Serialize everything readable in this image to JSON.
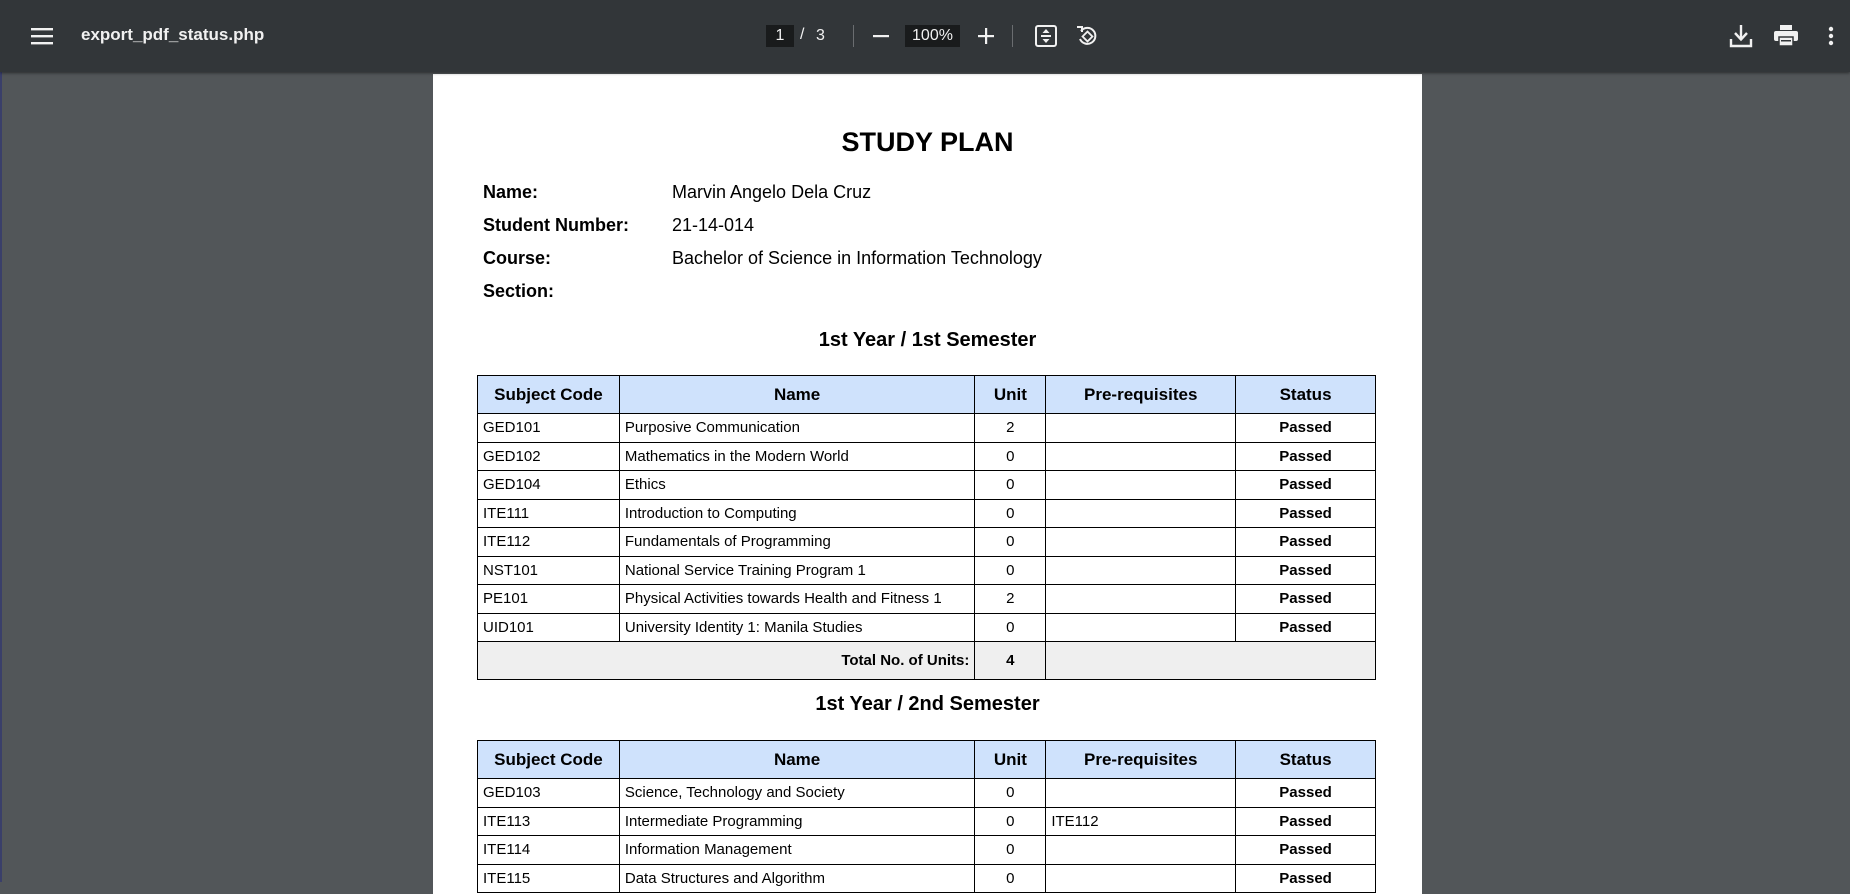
{
  "toolbar": {
    "file_name": "export_pdf_status.php",
    "current_page": "1",
    "page_separator": "/",
    "total_pages": "3",
    "zoom": "100%",
    "icons": [
      "menu-icon",
      "zoom-out-icon",
      "zoom-in-icon",
      "fit-page-icon",
      "rotate-icon",
      "download-icon",
      "print-icon",
      "more-vert-icon"
    ]
  },
  "document": {
    "title": "STUDY PLAN",
    "info": [
      {
        "label": "Name:",
        "value": "Marvin Angelo Dela Cruz"
      },
      {
        "label": "Student Number:",
        "value": "21-14-014"
      },
      {
        "label": "Course:",
        "value": "Bachelor of Science in Information Technology"
      },
      {
        "label": "Section:",
        "value": ""
      }
    ],
    "columns": [
      "Subject Code",
      "Name",
      "Unit",
      "Pre-requisites",
      "Status"
    ],
    "total_label": "Total No. of Units:",
    "semesters": [
      {
        "heading": "1st Year / 1st Semester",
        "rows": [
          {
            "code": "GED101",
            "name": "Purposive Communication",
            "unit": "2",
            "prereq": "",
            "status": "Passed"
          },
          {
            "code": "GED102",
            "name": "Mathematics in the Modern World",
            "unit": "0",
            "prereq": "",
            "status": "Passed"
          },
          {
            "code": "GED104",
            "name": "Ethics",
            "unit": "0",
            "prereq": "",
            "status": "Passed"
          },
          {
            "code": "ITE111",
            "name": "Introduction to Computing",
            "unit": "0",
            "prereq": "",
            "status": "Passed"
          },
          {
            "code": "ITE112",
            "name": "Fundamentals of Programming",
            "unit": "0",
            "prereq": "",
            "status": "Passed"
          },
          {
            "code": "NST101",
            "name": "National Service Training Program 1",
            "unit": "0",
            "prereq": "",
            "status": "Passed"
          },
          {
            "code": "PE101",
            "name": "Physical Activities towards Health and Fitness 1",
            "unit": "2",
            "prereq": "",
            "status": "Passed"
          },
          {
            "code": "UID101",
            "name": "University Identity 1: Manila Studies",
            "unit": "0",
            "prereq": "",
            "status": "Passed"
          }
        ],
        "total_units": "4"
      },
      {
        "heading": "1st Year / 2nd Semester",
        "rows": [
          {
            "code": "GED103",
            "name": "Science, Technology and Society",
            "unit": "0",
            "prereq": "",
            "status": "Passed"
          },
          {
            "code": "ITE113",
            "name": "Intermediate Programming",
            "unit": "0",
            "prereq": "ITE112",
            "status": "Passed"
          },
          {
            "code": "ITE114",
            "name": "Information Management",
            "unit": "0",
            "prereq": "",
            "status": "Passed"
          },
          {
            "code": "ITE115",
            "name": "Data Structures and Algorithm",
            "unit": "0",
            "prereq": "",
            "status": "Passed"
          }
        ]
      }
    ]
  }
}
